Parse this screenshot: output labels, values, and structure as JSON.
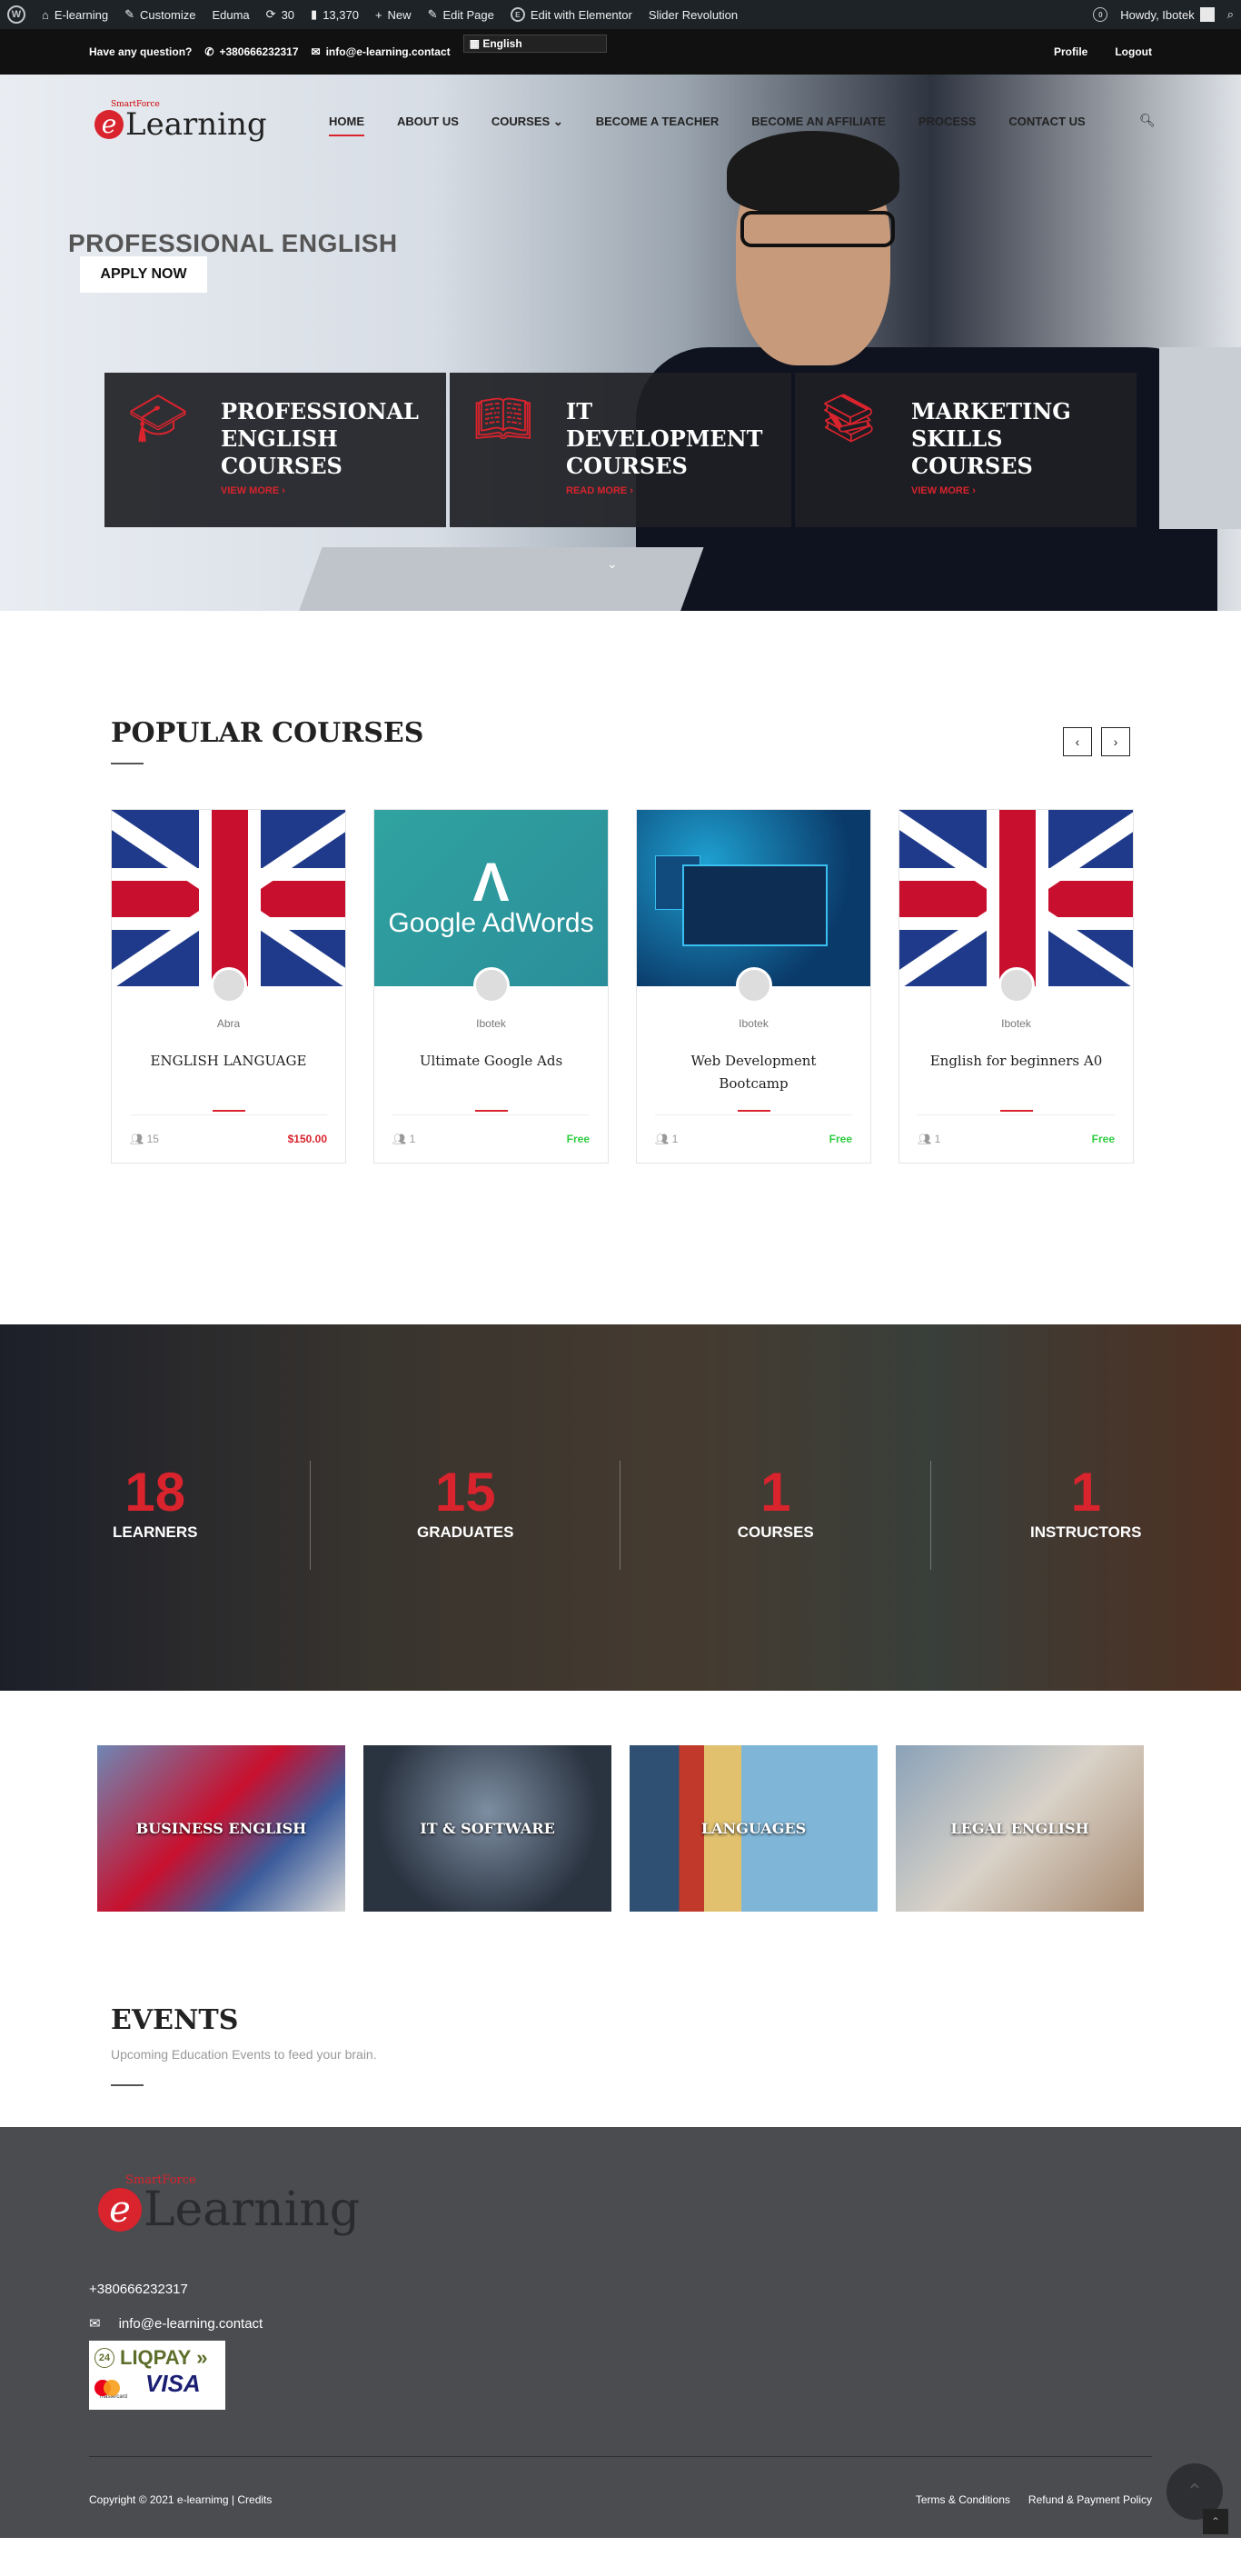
{
  "adminbar": {
    "items": [
      "E-learning",
      "Customize",
      "Eduma",
      "30",
      "13,370",
      "New",
      "Edit Page",
      "Edit with Elementor",
      "Slider Revolution"
    ],
    "howdy": "Howdy, Ibotek"
  },
  "topbar": {
    "question": "Have any question?",
    "phone": "+380666232317",
    "email": "info@e-learning.contact",
    "language": "English",
    "profile": "Profile",
    "logout": "Logout"
  },
  "logo": {
    "small": "SmartForce",
    "big": "Learning",
    "e": "e"
  },
  "nav": {
    "items": [
      "HOME",
      "ABOUT US",
      "COURSES",
      "BECOME A TEACHER",
      "BECOME AN AFFILIATE",
      "PROCESS",
      "CONTACT US"
    ],
    "active": "HOME"
  },
  "hero": {
    "tagline": "PROFESSIONAL ENGLISH",
    "apply": "APPLY NOW",
    "boxes": [
      {
        "title_lines": [
          "PROFESSIONAL",
          "ENGLISH",
          "COURSES"
        ],
        "more": "VIEW MORE",
        "icon": "graduation-cap-icon"
      },
      {
        "title_lines": [
          "IT",
          "DEVELOPMENT",
          "COURSES"
        ],
        "more": "READ MORE",
        "icon": "book-icon"
      },
      {
        "title_lines": [
          "MARKETING",
          "SKILLS",
          "COURSES"
        ],
        "more": "VIEW MORE",
        "icon": "books-icon"
      }
    ]
  },
  "popular": {
    "title": "POPULAR COURSES",
    "prev": "‹",
    "next": "›",
    "cards": [
      {
        "author": "Abra",
        "title": "ENGLISH LANGUAGE",
        "students": "15",
        "price": "$150.00",
        "thumb": "uk-flag"
      },
      {
        "author": "Ibotek",
        "title": "Ultimate Google Ads",
        "students": "1",
        "price": "Free",
        "thumb": "adwords"
      },
      {
        "author": "Ibotek",
        "title": "Web Development Bootcamp",
        "students": "1",
        "price": "Free",
        "thumb": "web"
      },
      {
        "author": "Ibotek",
        "title": "English for beginners A0",
        "students": "1",
        "price": "Free",
        "thumb": "uk-flag"
      }
    ]
  },
  "adwords": {
    "brand": "Google AdWords"
  },
  "stats": [
    {
      "n": "18",
      "l": "LEARNERS"
    },
    {
      "n": "15",
      "l": "GRADUATES"
    },
    {
      "n": "1",
      "l": "COURSES"
    },
    {
      "n": "1",
      "l": "INSTRUCTORS"
    }
  ],
  "categories": [
    "BUSINESS ENGLISH",
    "IT & SOFTWARE",
    "LANGUAGES",
    "LEGAL ENGLISH"
  ],
  "events": {
    "title": "EVENTS",
    "subtitle": "Upcoming Education Events to feed your brain."
  },
  "footer": {
    "phone": "+380666232317",
    "email": "info@e-learning.contact",
    "liqpay": "LIQPAY",
    "visa": "VISA",
    "mastercard": "mastercard",
    "copyright": "Copyright © 2021 e-learnimg | Credits",
    "links": [
      "Terms & Conditions",
      "Refund & Payment Policy"
    ]
  },
  "colors": {
    "accent": "#d9232d",
    "dark": "#111111",
    "footer": "#4b4c50"
  }
}
